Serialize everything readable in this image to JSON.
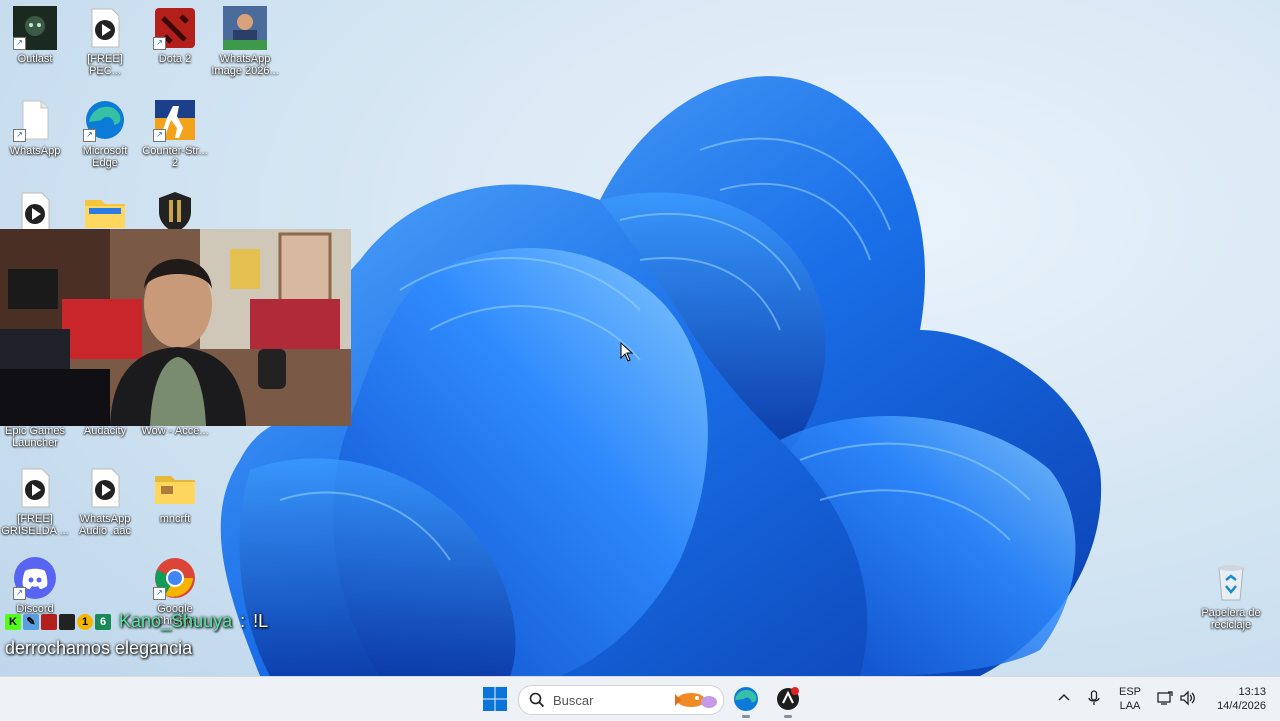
{
  "desktop": {
    "icons": [
      {
        "name": "outlast",
        "label": "Outlast",
        "icon": "outlast-icon"
      },
      {
        "name": "free-pec",
        "label": "[FREE] PEC...",
        "icon": "media-file-icon"
      },
      {
        "name": "dota2",
        "label": "Dota 2",
        "icon": "dota2-icon"
      },
      {
        "name": "whatsapp-image",
        "label": "WhatsApp Image 2026...",
        "icon": "image-thumbnail-icon"
      },
      {
        "name": "whatsapp",
        "label": "WhatsApp",
        "icon": "blank-file-icon"
      },
      {
        "name": "microsoft-edge",
        "label": "Microsoft Edge",
        "icon": "edge-icon"
      },
      {
        "name": "counter-strike",
        "label": "Counter-Str... 2",
        "icon": "counter-strike-icon"
      },
      {
        "name": "epic-games",
        "label": "Epic Games Launcher",
        "icon": "epic-games-icon"
      },
      {
        "name": "audacity",
        "label": "Audacity",
        "icon": "audacity-icon"
      },
      {
        "name": "wow",
        "label": "Wow - Acce...",
        "icon": "wow-icon"
      },
      {
        "name": "free-griselda",
        "label": "[FREE] GRISELDA ...",
        "icon": "media-file-icon"
      },
      {
        "name": "whatsapp-audio",
        "label": "WhatsApp Audio .aac",
        "icon": "media-file-icon"
      },
      {
        "name": "mncrft",
        "label": "mncrft",
        "icon": "folder-icon"
      },
      {
        "name": "discord",
        "label": "Discord",
        "icon": "discord-icon"
      },
      {
        "name": "google-chrome",
        "label": "Google Chrome",
        "icon": "chrome-icon"
      }
    ],
    "recycle_bin": {
      "label": "Papelera de reciclaje",
      "icon": "recycle-bin-icon"
    }
  },
  "chat_overlay": {
    "username": "Kano_Shuuya",
    "separator": ":",
    "command": "!L",
    "message": "derrochamos elegancia"
  },
  "taskbar": {
    "search_placeholder": "Buscar",
    "language_line1": "ESP",
    "language_line2": "LAA",
    "time": "13:13",
    "date": "14/4/2026"
  },
  "colors": {
    "accent": "#0067c0",
    "wallpaper_blue": "#1565e0",
    "taskbar_bg": "#eef2f7",
    "chat_username": "#57e3a0"
  }
}
